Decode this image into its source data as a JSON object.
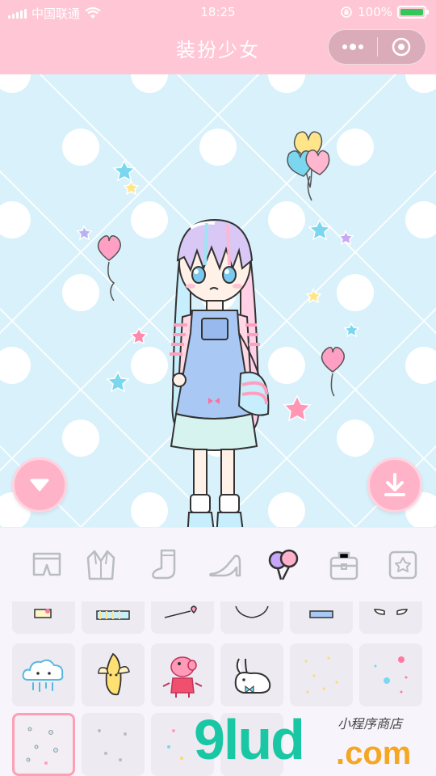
{
  "status_bar": {
    "carrier": "中国联通",
    "time": "18:25",
    "battery_percent": "100%"
  },
  "header": {
    "title": "装扮少女",
    "menu_icon": "more-dots-icon",
    "close_icon": "target-circle-icon"
  },
  "stage": {
    "collapse_icon": "triangle-down-icon",
    "download_icon": "download-icon"
  },
  "tabs": [
    {
      "name": "shorts",
      "icon": "shorts-icon"
    },
    {
      "name": "jacket",
      "icon": "jacket-icon"
    },
    {
      "name": "sock",
      "icon": "sock-icon"
    },
    {
      "name": "heel",
      "icon": "high-heel-icon"
    },
    {
      "name": "balloons",
      "icon": "balloons-icon",
      "active": true
    },
    {
      "name": "bag",
      "icon": "bag-icon"
    },
    {
      "name": "star",
      "icon": "star-frame-icon"
    }
  ],
  "items_row2": [
    {
      "icon": "cloud-icon"
    },
    {
      "icon": "banana-icon"
    },
    {
      "icon": "peppa-pig-icon"
    },
    {
      "icon": "rabbit-icon"
    },
    {
      "icon": "sparkle-pattern-icon"
    },
    {
      "icon": "flower-pattern-icon"
    }
  ],
  "watermark": {
    "logo": "9lud",
    "suffix": ".com",
    "subtitle": "小程序商店"
  },
  "colors": {
    "header_pink": "#ffc6d6",
    "stage_blue": "#d8f1fb",
    "button_pink": "#ffb3c8",
    "battery_green": "#33c759",
    "watermark_teal": "#19c7a4",
    "watermark_orange": "#f5a623"
  }
}
